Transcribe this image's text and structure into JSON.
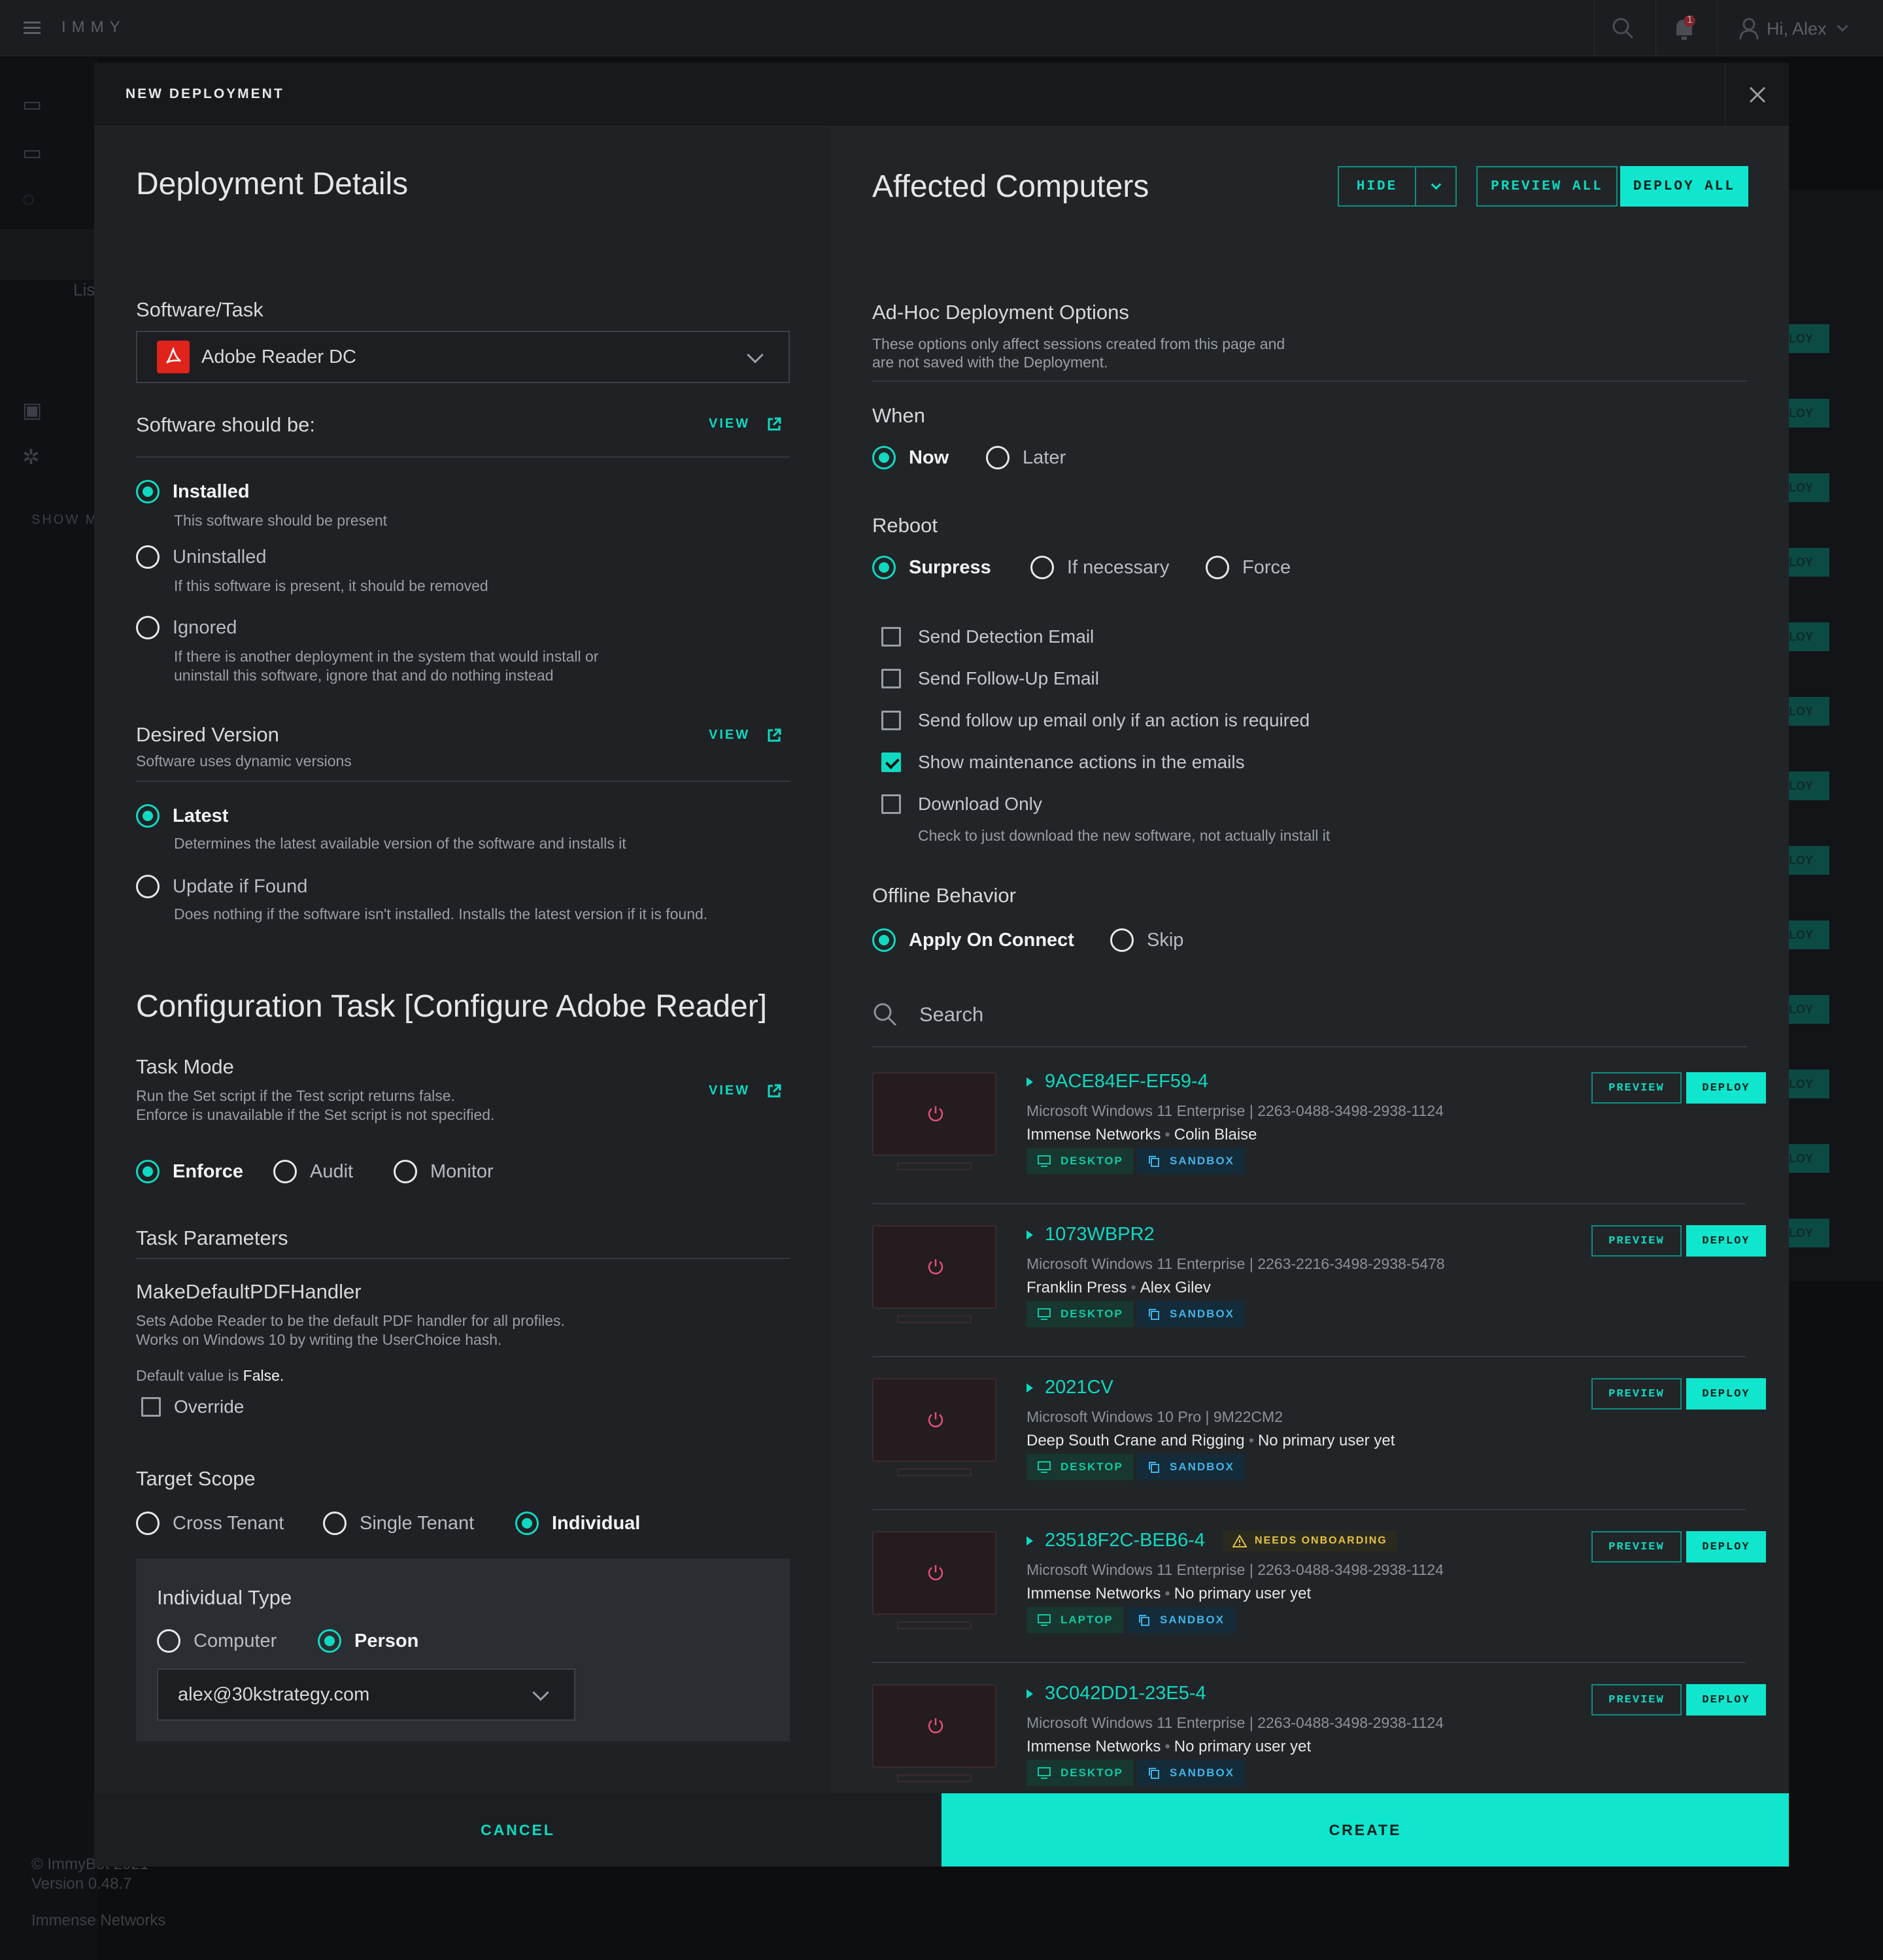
{
  "topbar": {
    "brand": "IMMY",
    "greeting": "Hi, Alex",
    "notification_count": "1"
  },
  "background": {
    "footer_copyright": "© ImmyBot 2021",
    "footer_version": "Version 0.48.7",
    "footer_tenant": "Immense Networks",
    "show_more": "SHOW M",
    "side_list": "Lis",
    "deploy_fragment": "LOY"
  },
  "modal": {
    "title": "NEW DEPLOYMENT",
    "details_title": "Deployment Details",
    "software_label": "Software/Task",
    "software_value": "Adobe Reader DC",
    "should_be_label": "Software should be:",
    "view_label": "VIEW",
    "states": [
      {
        "label": "Installed",
        "desc": "This software should be present",
        "selected": true
      },
      {
        "label": "Uninstalled",
        "desc": "If this software is present, it should be removed",
        "selected": false
      },
      {
        "label": "Ignored",
        "desc": "If there is another deployment in the system that would install or uninstall this software, ignore that and do nothing instead",
        "selected": false
      }
    ],
    "desired_version_label": "Desired Version",
    "desired_version_sub": "Software uses dynamic versions",
    "versions": [
      {
        "label": "Latest",
        "desc": "Determines the latest available version of the software and installs it",
        "selected": true
      },
      {
        "label": "Update if Found",
        "desc": "Does nothing if the software isn't installed. Installs the latest version if it is found.",
        "selected": false
      }
    ],
    "config_title": "Configuration Task [Configure Adobe Reader]",
    "task_mode_label": "Task Mode",
    "task_mode_sub1": "Run the Set script if the Test script returns false.",
    "task_mode_sub2": "Enforce is unavailable if the Set script is not specified.",
    "modes": [
      {
        "label": "Enforce",
        "selected": true
      },
      {
        "label": "Audit",
        "selected": false
      },
      {
        "label": "Monitor",
        "selected": false
      }
    ],
    "task_params_label": "Task Parameters",
    "param_name": "MakeDefaultPDFHandler",
    "param_desc1": "Sets Adobe Reader to be the default PDF handler for all profiles.",
    "param_desc2": "Works on Windows 10 by writing the UserChoice hash.",
    "param_default_prefix": "Default value is ",
    "param_default_value": "False.",
    "override_label": "Override",
    "target_scope_label": "Target Scope",
    "scopes": [
      {
        "label": "Cross Tenant",
        "selected": false
      },
      {
        "label": "Single Tenant",
        "selected": false
      },
      {
        "label": "Individual",
        "selected": true
      }
    ],
    "individual_type_label": "Individual Type",
    "individual_types": [
      {
        "label": "Computer",
        "selected": false
      },
      {
        "label": "Person",
        "selected": true
      }
    ],
    "person_value": "alex@30kstrategy.com",
    "affected_title": "Affected Computers",
    "hide_label": "HIDE",
    "preview_all_label": "PREVIEW ALL",
    "deploy_all_label": "DEPLOY ALL",
    "adhoc_title": "Ad-Hoc Deployment Options",
    "adhoc_sub1": "These options only affect sessions created from this page and",
    "adhoc_sub2": "are not saved with the Deployment.",
    "when_label": "When",
    "when_options": [
      {
        "label": "Now",
        "selected": true
      },
      {
        "label": "Later",
        "selected": false
      }
    ],
    "reboot_label": "Reboot",
    "reboot_options": [
      {
        "label": "Surpress",
        "selected": true
      },
      {
        "label": "If necessary",
        "selected": false
      },
      {
        "label": "Force",
        "selected": false
      }
    ],
    "email_options": [
      {
        "label": "Send Detection Email",
        "checked": false
      },
      {
        "label": "Send Follow-Up Email",
        "checked": false
      },
      {
        "label": "Send follow up email only if an action is required",
        "checked": false
      },
      {
        "label": "Show maintenance actions in the emails",
        "checked": true
      },
      {
        "label": "Download Only",
        "checked": false
      }
    ],
    "download_only_desc": "Check to just download the new software, not actually install it",
    "offline_label": "Offline Behavior",
    "offline_options": [
      {
        "label": "Apply On Connect",
        "selected": true
      },
      {
        "label": "Skip",
        "selected": false
      }
    ],
    "search_placeholder": "Search",
    "preview_label": "PREVIEW",
    "deploy_label": "DEPLOY",
    "tag_desktop": "DESKTOP",
    "tag_laptop": "LAPTOP",
    "tag_sandbox": "SANDBOX",
    "needs_onboarding": "NEEDS ONBOARDING",
    "computers": [
      {
        "name": "9ACE84EF-EF59-4",
        "os": "Microsoft Windows 11 Enterprise | 2263-0488-3498-2938-1124",
        "tenant": "Immense Networks",
        "user": "Colin Blaise",
        "type": "DESKTOP"
      },
      {
        "name": "1073WBPR2",
        "os": "Microsoft Windows 11 Enterprise | 2263-2216-3498-2938-5478",
        "tenant": "Franklin Press",
        "user": "Alex Gilev",
        "type": "DESKTOP"
      },
      {
        "name": "2021CV",
        "os": "Microsoft Windows 10 Pro | 9M22CM2",
        "tenant": "Deep South Crane and Rigging",
        "user": "No primary user yet",
        "type": "DESKTOP"
      },
      {
        "name": "23518F2C-BEB6-4",
        "os": "Microsoft Windows 11 Enterprise | 2263-0488-3498-2938-1124",
        "tenant": "Immense Networks",
        "user": "No primary user yet",
        "type": "LAPTOP"
      },
      {
        "name": "3C042DD1-23E5-4",
        "os": "Microsoft Windows 11 Enterprise | 2263-0488-3498-2938-1124",
        "tenant": "Immense Networks",
        "user": "No primary user yet",
        "type": "DESKTOP"
      }
    ],
    "cancel_label": "CANCEL",
    "create_label": "CREATE"
  },
  "colors": {
    "accent": "#0fe6cd",
    "warning": "#e3c247",
    "power": "#e0507a"
  }
}
